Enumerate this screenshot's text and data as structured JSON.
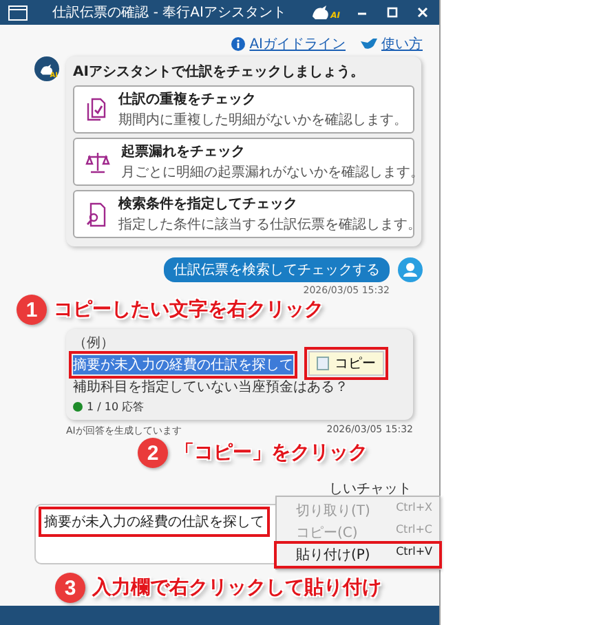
{
  "window": {
    "title": "仕訳伝票の確認 - 奉行AIアシスタント",
    "logo_text": "AI"
  },
  "header_links": [
    {
      "label": "AIガイドライン",
      "kind": "info"
    },
    {
      "label": "使い方",
      "kind": "bird"
    }
  ],
  "assistant": {
    "avatar_text": "AI",
    "title": "AIアシスタントで仕訳をチェックしましょう。",
    "options": [
      {
        "kind": "duplicate",
        "title": "仕訳の重複をチェック",
        "description": "期間内に重複した明細がないかを確認します。"
      },
      {
        "kind": "scale",
        "title": "起票漏れをチェック",
        "description": "月ごとに明細の起票漏れがないかを確認します。"
      },
      {
        "kind": "search",
        "title": "検索条件を指定してチェック",
        "description": "指定した条件に該当する仕訳伝票を確認します。"
      }
    ]
  },
  "user_message": {
    "text": "仕訳伝票を検索してチェックする",
    "time": "2026/03/05 15:32"
  },
  "response": {
    "example_label": "（例）",
    "lines": [
      {
        "text": "摘要が未入力の経費の仕訳を探して",
        "selected": true
      },
      {
        "text": "補助科目を指定していない当座預金はある？",
        "selected": false
      }
    ],
    "count": "1 / 10 応答",
    "status": "AIが回答を生成しています",
    "time": "2026/03/05 15:32"
  },
  "copy_popup": {
    "label": "コピー"
  },
  "new_chat": {
    "label": "しいチャット"
  },
  "input": {
    "value": "摘要が未入力の経費の仕訳を探して"
  },
  "context_menu": [
    {
      "label": "切り取り(T)",
      "shortcut": "Ctrl+X",
      "disabled": true
    },
    {
      "label": "コピー(C)",
      "shortcut": "Ctrl+C",
      "disabled": true
    },
    {
      "label": "貼り付け(P)",
      "shortcut": "Ctrl+V",
      "disabled": false
    }
  ],
  "annotations": [
    {
      "number": "1",
      "text": "コピーしたい文字を右クリック"
    },
    {
      "number": "2",
      "text": "「コピー」をクリック"
    },
    {
      "number": "3",
      "text": "入力欄で右クリックして貼り付け"
    }
  ]
}
